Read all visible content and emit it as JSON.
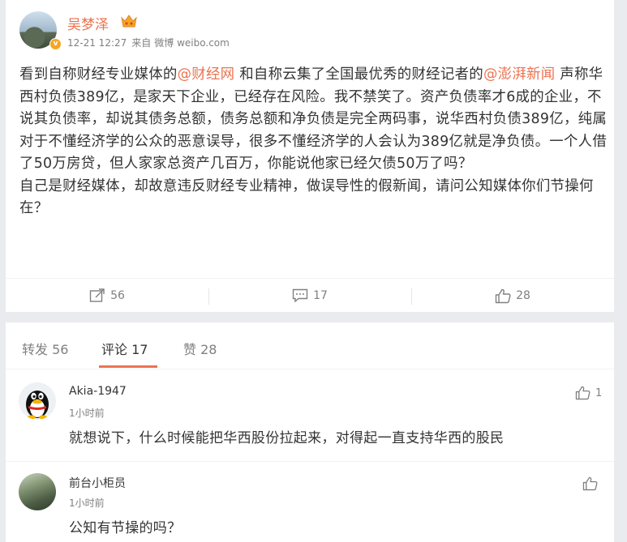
{
  "post": {
    "author": "吴梦泽",
    "verified_mark": "v",
    "meta": {
      "time": "12-21 12:27",
      "from": "来自",
      "source": "微博 weibo.com"
    },
    "body": {
      "p1_a": "看到自称财经专业媒体的",
      "mention1": "@财经网",
      "p1_b": " 和自称云集了全国最优秀的财经记者的",
      "mention2": "@澎湃新闻",
      "p1_c": " 声称华西村负债389亿，是家天下企业，已经存在风险。我不禁笑了。资产负债率才6成的企业，不说其负债率，却说其债务总额，债务总额和净负债是完全两码事，说华西村负债389亿，纯属对于不懂经济学的公众的恶意误导，很多不懂经济学的人会认为389亿就是净负债。一个人借了50万房贷，但人家家总资产几百万，你能说他家已经欠债50万了吗？",
      "p2": "自己是财经媒体，却故意违反财经专业精神，做误导性的假新闻，请问公知媒体你们节操何在？"
    },
    "actions": {
      "repost_count": "56",
      "comment_count": "17",
      "like_count": "28"
    }
  },
  "tabs": {
    "repost": "转发 56",
    "comment": "评论 17",
    "like": "赞 28"
  },
  "comments": [
    {
      "name": "Akia-1947",
      "time": "1小时前",
      "text": "就想说下，什么时候能把华西股份拉起来，对得起一直支持华西的股民",
      "likes": "1"
    },
    {
      "name": "前台小柜员",
      "time": "1小时前",
      "text": "公知有节操的吗？",
      "likes": ""
    }
  ],
  "colors": {
    "accent": "#eb7350",
    "text": "#333333",
    "muted": "#808080",
    "background": "#e9ebee"
  },
  "icons": {
    "repost": "share-icon",
    "comment": "comment-icon",
    "like": "thumbs-up-icon",
    "vip": "vip-crown-icon"
  }
}
